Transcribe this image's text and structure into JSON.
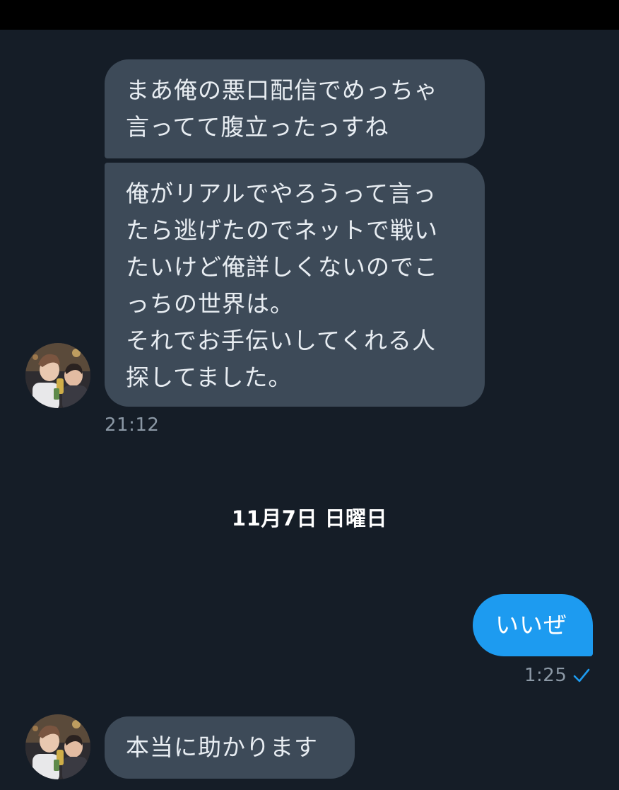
{
  "messages": [
    {
      "direction": "incoming",
      "text": "まあ俺の悪口配信でめっちゃ\n言ってて腹立ったっすね"
    },
    {
      "direction": "incoming",
      "text": "俺がリアルでやろうって言っ\nたら逃げたのでネットで戦い\nたいけど俺詳しくないのでこ\nっちの世界は。\nそれでお手伝いしてくれる人\n探してました。",
      "time": "21:12"
    },
    {
      "direction": "outgoing",
      "text": "いいぜ",
      "time": "1:25"
    },
    {
      "direction": "incoming",
      "text": "本当に助かります"
    }
  ],
  "date_separator": "11月7日 日曜日",
  "avatar_icon": "profile-photo",
  "read_receipt_icon": "checkmark-icon",
  "colors": {
    "background": "#151d27",
    "incoming_bubble": "#3d4a58",
    "outgoing_bubble": "#1d9bf0",
    "timestamp": "#8b98a5",
    "status_bar": "#000000"
  }
}
